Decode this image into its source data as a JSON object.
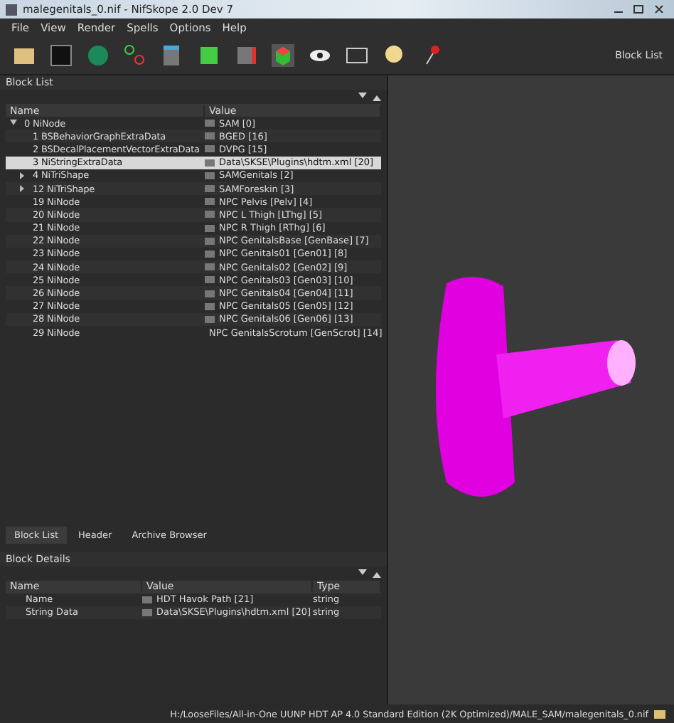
{
  "window": {
    "title": "malegenitals_0.nif - NifSkope 2.0 Dev 7"
  },
  "menu": [
    "File",
    "View",
    "Render",
    "Spells",
    "Options",
    "Help"
  ],
  "toolbar": {
    "label": "Block List"
  },
  "block_list": {
    "title": "Block List",
    "columns": [
      "Name",
      "Value"
    ],
    "rows": [
      {
        "name": "0 NiNode",
        "value": "SAM [0]",
        "expanded": true,
        "selected": false,
        "children": [
          {
            "name": "1 BSBehaviorGraphExtraData",
            "value": "BGED [16]",
            "selected": false
          },
          {
            "name": "2 BSDecalPlacementVectorExtraData",
            "value": "DVPG [15]",
            "selected": false
          },
          {
            "name": "3 NiStringExtraData",
            "value": "Data\\SKSE\\Plugins\\hdtm.xml [20]",
            "selected": true
          },
          {
            "name": "4 NiTriShape",
            "value": "SAMGenitals [2]",
            "expanded": false,
            "selected": false
          },
          {
            "name": "12 NiTriShape",
            "value": "SAMForeskin [3]",
            "expanded": false,
            "selected": false
          },
          {
            "name": "19 NiNode",
            "value": "NPC Pelvis [Pelv] [4]",
            "selected": false
          },
          {
            "name": "20 NiNode",
            "value": "NPC L Thigh [LThg] [5]",
            "selected": false
          },
          {
            "name": "21 NiNode",
            "value": "NPC R Thigh [RThg] [6]",
            "selected": false
          },
          {
            "name": "22 NiNode",
            "value": "NPC GenitalsBase [GenBase] [7]",
            "selected": false
          },
          {
            "name": "23 NiNode",
            "value": "NPC Genitals01 [Gen01] [8]",
            "selected": false
          },
          {
            "name": "24 NiNode",
            "value": "NPC Genitals02 [Gen02] [9]",
            "selected": false
          },
          {
            "name": "25 NiNode",
            "value": "NPC Genitals03 [Gen03] [10]",
            "selected": false
          },
          {
            "name": "26 NiNode",
            "value": "NPC Genitals04 [Gen04] [11]",
            "selected": false
          },
          {
            "name": "27 NiNode",
            "value": "NPC Genitals05 [Gen05] [12]",
            "selected": false
          },
          {
            "name": "28 NiNode",
            "value": "NPC Genitals06 [Gen06] [13]",
            "selected": false
          },
          {
            "name": "29 NiNode",
            "value": "NPC GenitalsScrotum [GenScrot] [14]",
            "selected": false
          }
        ]
      }
    ]
  },
  "tabs": [
    {
      "label": "Block List",
      "selected": true
    },
    {
      "label": "Header",
      "selected": false
    },
    {
      "label": "Archive Browser",
      "selected": false
    }
  ],
  "block_details": {
    "title": "Block Details",
    "columns": [
      "Name",
      "Value",
      "Type"
    ],
    "rows": [
      {
        "name": "Name",
        "value": "HDT Havok Path [21]",
        "type": "string"
      },
      {
        "name": "String Data",
        "value": "Data\\SKSE\\Plugins\\hdtm.xml [20]",
        "type": "string"
      }
    ]
  },
  "status_bar": {
    "path": "H:/LooseFiles/All-in-One UUNP HDT AP 4.0 Standard Edition (2K Optimized)/MALE_SAM/malegenitals_0.nif"
  }
}
